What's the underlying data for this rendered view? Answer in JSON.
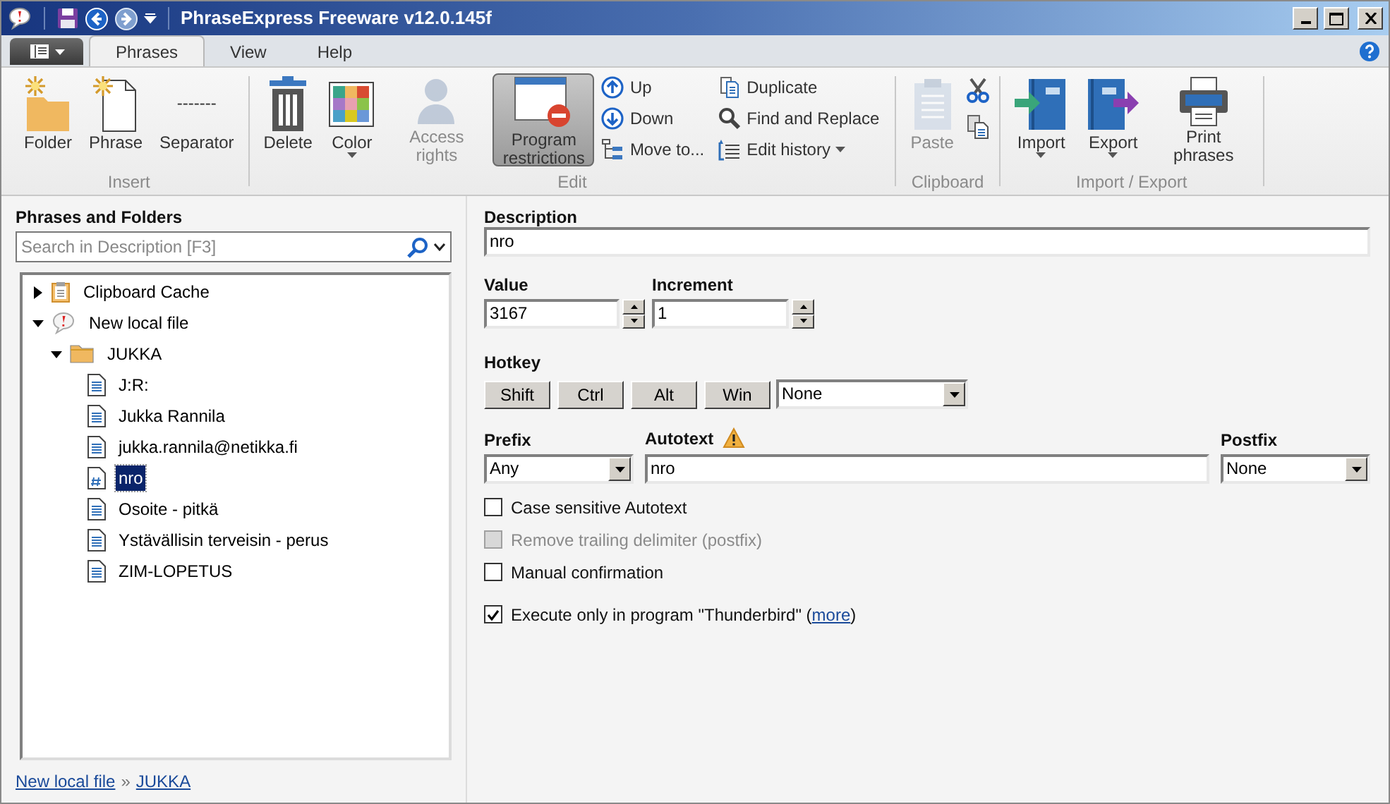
{
  "window": {
    "title": "PhraseExpress Freeware v12.0.145f"
  },
  "tabs": [
    {
      "label": "Phrases",
      "selected": true
    },
    {
      "label": "View",
      "selected": false
    },
    {
      "label": "Help",
      "selected": false
    }
  ],
  "ribbon": [
    {
      "label": "Insert",
      "items": [
        {
          "kind": "large",
          "label": "Folder",
          "disabled": false,
          "selected": false
        },
        {
          "kind": "large",
          "label": "Phrase",
          "disabled": false,
          "selected": false
        },
        {
          "kind": "text",
          "label": "Separator",
          "glyph": "-------",
          "disabled": false,
          "selected": false
        }
      ]
    },
    {
      "label": "Edit",
      "items": [
        {
          "kind": "large",
          "label": "Delete",
          "disabled": false,
          "selected": false
        },
        {
          "kind": "large",
          "label": "Color",
          "dropdown": true,
          "disabled": false,
          "selected": false
        },
        {
          "kind": "large",
          "label": "Access rights",
          "disabled": true,
          "selected": false
        },
        {
          "kind": "large",
          "label": "Program restrictions",
          "disabled": false,
          "selected": true
        },
        {
          "kind": "small",
          "label": "Up",
          "disabled": false,
          "selected": false
        },
        {
          "kind": "small",
          "label": "Down",
          "disabled": false,
          "selected": false
        },
        {
          "kind": "small",
          "label": "Move to...",
          "disabled": false,
          "selected": false
        },
        {
          "kind": "small",
          "label": "Duplicate",
          "disabled": false,
          "selected": false
        },
        {
          "kind": "small",
          "label": "Find and Replace",
          "disabled": false,
          "selected": false
        },
        {
          "kind": "small",
          "label": "Edit history",
          "dropdown": true,
          "disabled": false,
          "selected": false
        }
      ]
    },
    {
      "label": "Clipboard",
      "items": [
        {
          "kind": "large",
          "label": "Paste",
          "disabled": true,
          "selected": false
        },
        {
          "kind": "icon",
          "disabled": false,
          "selected": false
        },
        {
          "kind": "icon",
          "disabled": false,
          "selected": false
        }
      ]
    },
    {
      "label": "Import / Export",
      "items": [
        {
          "kind": "large",
          "label": "Import",
          "dropdown": true,
          "disabled": false,
          "selected": false
        },
        {
          "kind": "large",
          "label": "Export",
          "dropdown": true,
          "disabled": false,
          "selected": false
        },
        {
          "kind": "large",
          "label": "Print phrases",
          "disabled": false,
          "selected": false
        }
      ]
    }
  ],
  "tree": {
    "label": "Phrases and Folders",
    "search": {
      "placeholder": "Search in Description [F3]"
    },
    "items": [
      {
        "kind": "cache",
        "label": "Clipboard Cache",
        "expanded": false,
        "selected": false
      },
      {
        "kind": "file",
        "label": "New local file",
        "expanded": true,
        "selected": false,
        "children": [
          {
            "kind": "folder",
            "label": "JUKKA",
            "expanded": true,
            "selected": false,
            "children": [
              {
                "kind": "phrase",
                "label": "J:R:",
                "selected": false
              },
              {
                "kind": "phrase",
                "label": "Jukka Rannila",
                "selected": false
              },
              {
                "kind": "phrase",
                "label": "jukka.rannila@netikka.fi",
                "selected": false
              },
              {
                "kind": "counter",
                "label": "nro",
                "selected": true
              },
              {
                "kind": "phrase",
                "label": "Osoite - pitkä",
                "selected": false
              },
              {
                "kind": "phrase",
                "label": "Ystävällisin terveisin - perus",
                "selected": false
              },
              {
                "kind": "phrase",
                "label": "ZIM-LOPETUS",
                "selected": false
              }
            ]
          }
        ]
      }
    ]
  },
  "breadcrumb": {
    "path": [
      "New local file",
      "JUKKA"
    ],
    "separator": "»"
  },
  "form": {
    "description": {
      "label": "Description",
      "value": "nro"
    },
    "value": {
      "label": "Value",
      "value": "3167"
    },
    "increment": {
      "label": "Increment",
      "value": "1"
    },
    "hotkey": {
      "label": "Hotkey",
      "modifiers": [
        "Shift",
        "Ctrl",
        "Alt",
        "Win"
      ],
      "key": "None"
    },
    "prefix": {
      "label": "Prefix",
      "value": "Any"
    },
    "autotext": {
      "label": "Autotext",
      "value": "nro",
      "warning": true
    },
    "postfix": {
      "label": "Postfix",
      "value": "None"
    },
    "options": [
      {
        "label": "Case sensitive Autotext",
        "checked": false,
        "disabled": false
      },
      {
        "label": "Remove trailing delimiter (postfix)",
        "checked": false,
        "disabled": true
      },
      {
        "label": "Manual confirmation",
        "checked": false,
        "disabled": false
      },
      {
        "label": "Execute only in program \"Thunderbird\" (",
        "link": "more",
        "suffix": ")",
        "checked": true,
        "disabled": false
      }
    ]
  }
}
